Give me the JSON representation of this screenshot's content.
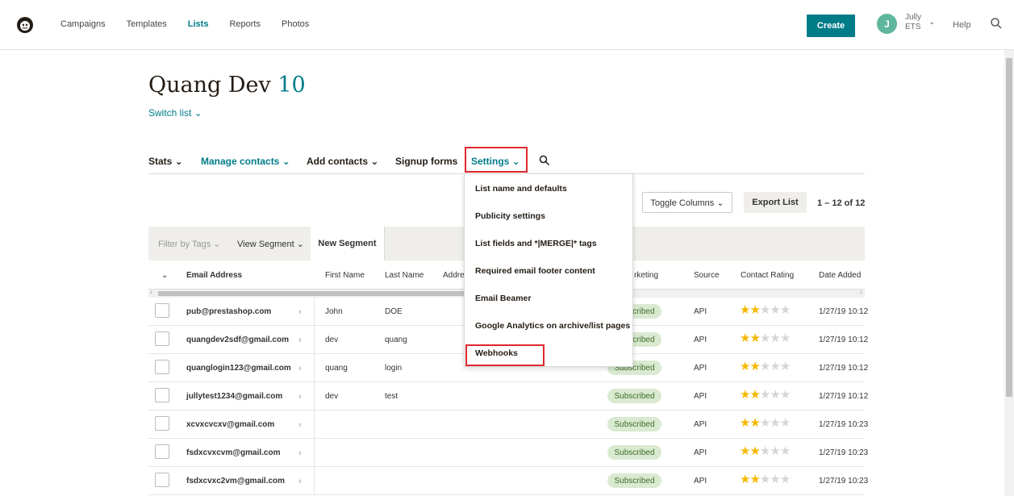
{
  "nav": {
    "links": [
      "Campaigns",
      "Templates",
      "Lists",
      "Reports",
      "Photos"
    ],
    "active": "Lists",
    "create_label": "Create",
    "avatar_initial": "J",
    "account_name_line1": "Jully",
    "account_name_line2": "ETS",
    "help_label": "Help",
    "search_icon": "search-icon"
  },
  "page": {
    "title": "Quang Dev",
    "count": "10",
    "switch_list": "Switch list ⌄"
  },
  "subnav": {
    "stats": "Stats ⌄",
    "manage_contacts": "Manage contacts ⌄",
    "add_contacts": "Add contacts ⌄",
    "signup_forms": "Signup forms",
    "settings": "Settings ⌄"
  },
  "toolbar": {
    "toggle_columns": "Toggle Columns ⌄",
    "export_list": "Export List",
    "pager": "1 – 12 of 12"
  },
  "filter": {
    "filter_by_tags": "Filter by Tags ⌄",
    "view_segment": "View Segment ⌄",
    "new_segment": "New Segment"
  },
  "table": {
    "headers": {
      "email": "Email Address",
      "first": "First Name",
      "last": "Last Name",
      "address": "Addre",
      "marketing": "rketing",
      "source": "Source",
      "rating": "Contact Rating",
      "date": "Date Added"
    },
    "rows": [
      {
        "email": "pub@prestashop.com",
        "first": "John",
        "last": "DOE",
        "status": "Subscribed",
        "source": "API",
        "date": "1/27/19 10:12"
      },
      {
        "email": "quangdev2sdf@gmail.com",
        "first": "dev",
        "last": "quang",
        "status": "Subscribed",
        "source": "API",
        "date": "1/27/19 10:12"
      },
      {
        "email": "quanglogin123@gmail.com",
        "first": "quang",
        "last": "login",
        "status": "Subscribed",
        "source": "API",
        "date": "1/27/19 10:12"
      },
      {
        "email": "jullytest1234@gmail.com",
        "first": "dev",
        "last": "test",
        "status": "Subscribed",
        "source": "API",
        "date": "1/27/19 10:12"
      },
      {
        "email": "xcvxcvcxv@gmail.com",
        "first": "",
        "last": "",
        "status": "Subscribed",
        "source": "API",
        "date": "1/27/19 10:23"
      },
      {
        "email": "fsdxcvxcvm@gmail.com",
        "first": "",
        "last": "",
        "status": "Subscribed",
        "source": "API",
        "date": "1/27/19 10:23"
      },
      {
        "email": "fsdxcvxc2vm@gmail.com",
        "first": "",
        "last": "",
        "status": "Subscribed",
        "source": "API",
        "date": "1/27/19 10:23"
      }
    ],
    "rating_stars": 2,
    "rating_max": 5
  },
  "settings_menu": {
    "items": [
      "List name and defaults",
      "Publicity settings",
      "List fields and *|MERGE|* tags",
      "Required email footer content",
      "Email Beamer",
      "Google Analytics on archive/list pages",
      "Webhooks"
    ]
  },
  "colors": {
    "brand_teal": "#007c89",
    "highlight_red": "#e0282d",
    "badge_green": "#d9ead1",
    "star_gold": "#f5b800"
  }
}
